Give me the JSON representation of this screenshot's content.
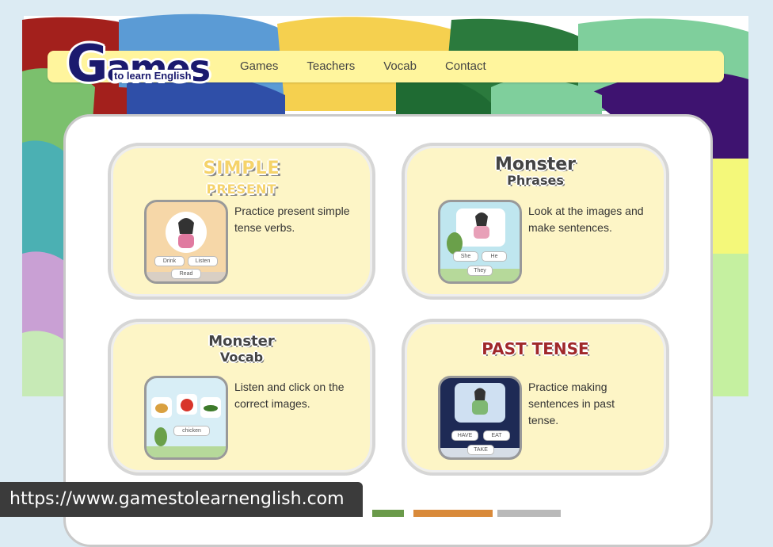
{
  "logo": {
    "word": "Games",
    "first_letter": "G",
    "rest": "ames",
    "subtitle": "to learn English"
  },
  "nav": {
    "links": [
      "Games",
      "Teachers",
      "Vocab",
      "Contact"
    ]
  },
  "cards": [
    {
      "title": "SIMPLE PRESENT",
      "title_line1": "SIMPLE",
      "title_line2": "PRESENT",
      "description": "Practice present simple tense verbs.",
      "thumb_labels": [
        "Drink",
        "Listen",
        "Read"
      ]
    },
    {
      "title": "Monster Phrases",
      "title_line1": "Monster",
      "title_line2": "Phrases",
      "description": "Look at the images and make sentences.",
      "thumb_labels": [
        "She",
        "He",
        "They"
      ]
    },
    {
      "title": "Monster Vocab",
      "title_line1": "Monster",
      "title_line2": "Vocab",
      "description": "Listen and click on the correct images.",
      "thumb_labels": [
        "chicken"
      ]
    },
    {
      "title": "PAST TENSE",
      "title_line1": "PAST TENSE",
      "description": "Practice making sentences in past tense.",
      "thumb_labels": [
        "HAVE",
        "EAT",
        "TAKE"
      ]
    }
  ],
  "status_url": "https://www.gamestolearnenglish.com",
  "colors": {
    "nav_bg": "#fff59d",
    "card_bg": "#fdf5c6",
    "logo": "#1b1a6e",
    "past_tense": "#a0282a"
  }
}
